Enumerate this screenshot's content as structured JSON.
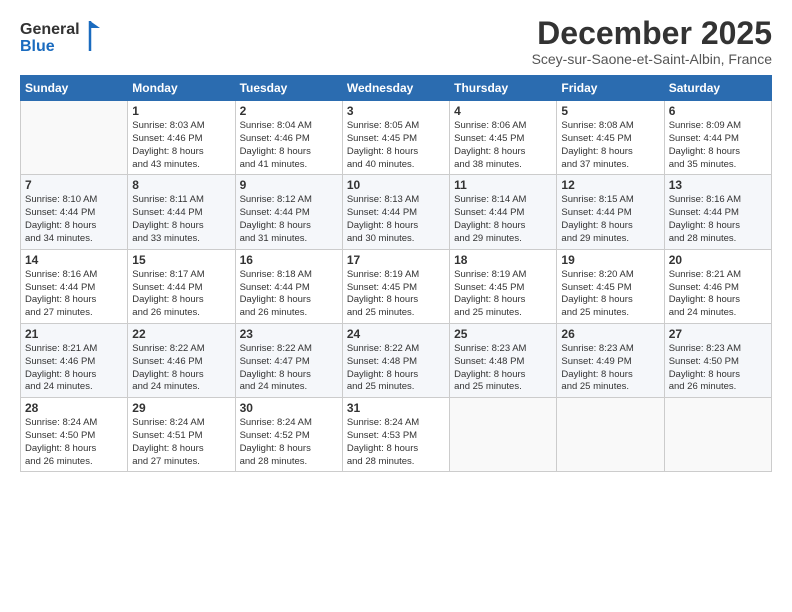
{
  "header": {
    "logo_general": "General",
    "logo_blue": "Blue",
    "month_title": "December 2025",
    "subtitle": "Scey-sur-Saone-et-Saint-Albin, France"
  },
  "weekdays": [
    "Sunday",
    "Monday",
    "Tuesday",
    "Wednesday",
    "Thursday",
    "Friday",
    "Saturday"
  ],
  "weeks": [
    [
      {
        "day": "",
        "sunrise": "",
        "sunset": "",
        "daylight": ""
      },
      {
        "day": "1",
        "sunrise": "Sunrise: 8:03 AM",
        "sunset": "Sunset: 4:46 PM",
        "daylight": "Daylight: 8 hours and 43 minutes."
      },
      {
        "day": "2",
        "sunrise": "Sunrise: 8:04 AM",
        "sunset": "Sunset: 4:46 PM",
        "daylight": "Daylight: 8 hours and 41 minutes."
      },
      {
        "day": "3",
        "sunrise": "Sunrise: 8:05 AM",
        "sunset": "Sunset: 4:45 PM",
        "daylight": "Daylight: 8 hours and 40 minutes."
      },
      {
        "day": "4",
        "sunrise": "Sunrise: 8:06 AM",
        "sunset": "Sunset: 4:45 PM",
        "daylight": "Daylight: 8 hours and 38 minutes."
      },
      {
        "day": "5",
        "sunrise": "Sunrise: 8:08 AM",
        "sunset": "Sunset: 4:45 PM",
        "daylight": "Daylight: 8 hours and 37 minutes."
      },
      {
        "day": "6",
        "sunrise": "Sunrise: 8:09 AM",
        "sunset": "Sunset: 4:44 PM",
        "daylight": "Daylight: 8 hours and 35 minutes."
      }
    ],
    [
      {
        "day": "7",
        "sunrise": "Sunrise: 8:10 AM",
        "sunset": "Sunset: 4:44 PM",
        "daylight": "Daylight: 8 hours and 34 minutes."
      },
      {
        "day": "8",
        "sunrise": "Sunrise: 8:11 AM",
        "sunset": "Sunset: 4:44 PM",
        "daylight": "Daylight: 8 hours and 33 minutes."
      },
      {
        "day": "9",
        "sunrise": "Sunrise: 8:12 AM",
        "sunset": "Sunset: 4:44 PM",
        "daylight": "Daylight: 8 hours and 31 minutes."
      },
      {
        "day": "10",
        "sunrise": "Sunrise: 8:13 AM",
        "sunset": "Sunset: 4:44 PM",
        "daylight": "Daylight: 8 hours and 30 minutes."
      },
      {
        "day": "11",
        "sunrise": "Sunrise: 8:14 AM",
        "sunset": "Sunset: 4:44 PM",
        "daylight": "Daylight: 8 hours and 29 minutes."
      },
      {
        "day": "12",
        "sunrise": "Sunrise: 8:15 AM",
        "sunset": "Sunset: 4:44 PM",
        "daylight": "Daylight: 8 hours and 29 minutes."
      },
      {
        "day": "13",
        "sunrise": "Sunrise: 8:16 AM",
        "sunset": "Sunset: 4:44 PM",
        "daylight": "Daylight: 8 hours and 28 minutes."
      }
    ],
    [
      {
        "day": "14",
        "sunrise": "Sunrise: 8:16 AM",
        "sunset": "Sunset: 4:44 PM",
        "daylight": "Daylight: 8 hours and 27 minutes."
      },
      {
        "day": "15",
        "sunrise": "Sunrise: 8:17 AM",
        "sunset": "Sunset: 4:44 PM",
        "daylight": "Daylight: 8 hours and 26 minutes."
      },
      {
        "day": "16",
        "sunrise": "Sunrise: 8:18 AM",
        "sunset": "Sunset: 4:44 PM",
        "daylight": "Daylight: 8 hours and 26 minutes."
      },
      {
        "day": "17",
        "sunrise": "Sunrise: 8:19 AM",
        "sunset": "Sunset: 4:45 PM",
        "daylight": "Daylight: 8 hours and 25 minutes."
      },
      {
        "day": "18",
        "sunrise": "Sunrise: 8:19 AM",
        "sunset": "Sunset: 4:45 PM",
        "daylight": "Daylight: 8 hours and 25 minutes."
      },
      {
        "day": "19",
        "sunrise": "Sunrise: 8:20 AM",
        "sunset": "Sunset: 4:45 PM",
        "daylight": "Daylight: 8 hours and 25 minutes."
      },
      {
        "day": "20",
        "sunrise": "Sunrise: 8:21 AM",
        "sunset": "Sunset: 4:46 PM",
        "daylight": "Daylight: 8 hours and 24 minutes."
      }
    ],
    [
      {
        "day": "21",
        "sunrise": "Sunrise: 8:21 AM",
        "sunset": "Sunset: 4:46 PM",
        "daylight": "Daylight: 8 hours and 24 minutes."
      },
      {
        "day": "22",
        "sunrise": "Sunrise: 8:22 AM",
        "sunset": "Sunset: 4:46 PM",
        "daylight": "Daylight: 8 hours and 24 minutes."
      },
      {
        "day": "23",
        "sunrise": "Sunrise: 8:22 AM",
        "sunset": "Sunset: 4:47 PM",
        "daylight": "Daylight: 8 hours and 24 minutes."
      },
      {
        "day": "24",
        "sunrise": "Sunrise: 8:22 AM",
        "sunset": "Sunset: 4:48 PM",
        "daylight": "Daylight: 8 hours and 25 minutes."
      },
      {
        "day": "25",
        "sunrise": "Sunrise: 8:23 AM",
        "sunset": "Sunset: 4:48 PM",
        "daylight": "Daylight: 8 hours and 25 minutes."
      },
      {
        "day": "26",
        "sunrise": "Sunrise: 8:23 AM",
        "sunset": "Sunset: 4:49 PM",
        "daylight": "Daylight: 8 hours and 25 minutes."
      },
      {
        "day": "27",
        "sunrise": "Sunrise: 8:23 AM",
        "sunset": "Sunset: 4:50 PM",
        "daylight": "Daylight: 8 hours and 26 minutes."
      }
    ],
    [
      {
        "day": "28",
        "sunrise": "Sunrise: 8:24 AM",
        "sunset": "Sunset: 4:50 PM",
        "daylight": "Daylight: 8 hours and 26 minutes."
      },
      {
        "day": "29",
        "sunrise": "Sunrise: 8:24 AM",
        "sunset": "Sunset: 4:51 PM",
        "daylight": "Daylight: 8 hours and 27 minutes."
      },
      {
        "day": "30",
        "sunrise": "Sunrise: 8:24 AM",
        "sunset": "Sunset: 4:52 PM",
        "daylight": "Daylight: 8 hours and 28 minutes."
      },
      {
        "day": "31",
        "sunrise": "Sunrise: 8:24 AM",
        "sunset": "Sunset: 4:53 PM",
        "daylight": "Daylight: 8 hours and 28 minutes."
      },
      {
        "day": "",
        "sunrise": "",
        "sunset": "",
        "daylight": ""
      },
      {
        "day": "",
        "sunrise": "",
        "sunset": "",
        "daylight": ""
      },
      {
        "day": "",
        "sunrise": "",
        "sunset": "",
        "daylight": ""
      }
    ]
  ]
}
